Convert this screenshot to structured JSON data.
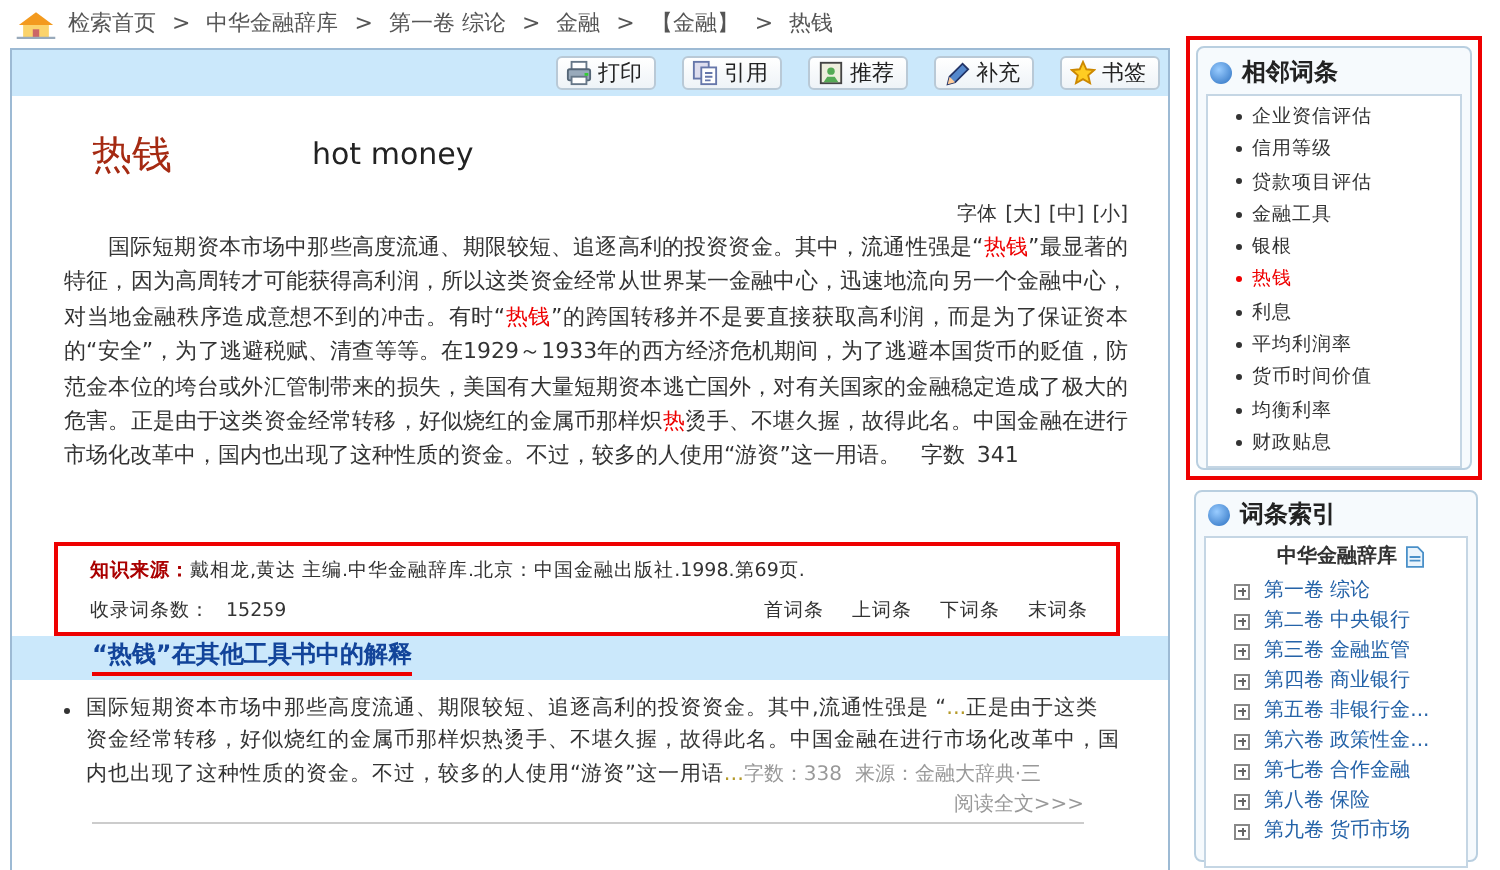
{
  "breadcrumb": [
    "检索首页",
    "中华金融辞库",
    "第一卷 综论",
    "金融",
    "【金融】",
    "热钱"
  ],
  "breadcrumb_separator": ">",
  "toolbar": [
    {
      "label": "打印",
      "kind": "print"
    },
    {
      "label": "引用",
      "kind": "cite"
    },
    {
      "label": "推荐",
      "kind": "recommend"
    },
    {
      "label": "补充",
      "kind": "supplement"
    },
    {
      "label": "书签",
      "kind": "bookmark"
    }
  ],
  "entry": {
    "title": "热钱",
    "english": "hot money",
    "font_size": {
      "label": "字体",
      "options": [
        "[大]",
        "[中]",
        "[小]"
      ]
    },
    "body": [
      {
        "text": "国际短期资本市场中那些高度流通、期限较短、追逐高利的投资资金。其中，流通性强是“",
        "highlight": false
      },
      {
        "text": "热钱",
        "highlight": true
      },
      {
        "text": "”最显著的特征，因为高周转才可能获得高利润，所以这类资金经常从世界某一金融中心，迅速地流向另一个金融中心，对当地金融秩序造成意想不到的冲击。有时“",
        "highlight": false
      },
      {
        "text": "热钱",
        "highlight": true
      },
      {
        "text": "”的跨国转移并不是要直接获取高利润，而是为了保证资本的“安全”，为了逃避税赋、清查等等。在1929～1933年的西方经济危机期间，为了逃避本国货币的贬值，防范金本位的垮台或外汇管制带来的损失，美国有大量短期资本逃亡国外，对有关国家的金融稳定造成了极大的危害。正是由于这类资金经常转移，好似烧红的金属币那样炽",
        "highlight": false
      },
      {
        "text": "热",
        "highlight": true
      },
      {
        "text": "烫手、不堪久握，故得此名。中国金融在进行市场化改革中，国内也出现了这种性质的资金。不过，较多的人使用“游资”这一用语。",
        "highlight": false
      }
    ],
    "char_count_label": "字数",
    "char_count": "341"
  },
  "source": {
    "label": "知识来源：",
    "text": "戴相龙,黄达 主编.中华金融辞库.北京：中国金融出版社.1998.第69页.",
    "count_label": "收录词条数：",
    "count": "15259",
    "nav": [
      "首词条",
      "上词条",
      "下词条",
      "末词条"
    ]
  },
  "other_tools": {
    "heading": "“热钱”在其他工具书中的解释",
    "results": [
      {
        "snippet": "国际短期资本市场中那些高度流通、期限较短、追逐高利的投资资金。其中,流通性强是 “",
        "ellipsis_before": "...",
        "snippet_end": "正是由于这类资金经常转移，好似烧红的金属币那样炽热烫手、不堪久握，故得此名。中国金融在进行市场化改革中，国内也出现了这种性质的资金。不过，较多的人使用“游资”这一用语",
        "ellipsis_after": "...",
        "meta": "字数：338  来源：金融大辞典·三"
      }
    ],
    "read_more": "阅读全文>>>"
  },
  "related": {
    "title": "相邻词条",
    "items": [
      {
        "label": "企业资信评估",
        "selected": false
      },
      {
        "label": "信用等级",
        "selected": false
      },
      {
        "label": "贷款项目评估",
        "selected": false
      },
      {
        "label": "金融工具",
        "selected": false
      },
      {
        "label": "银根",
        "selected": false
      },
      {
        "label": "热钱",
        "selected": true
      },
      {
        "label": "利息",
        "selected": false
      },
      {
        "label": "平均利润率",
        "selected": false
      },
      {
        "label": "货币时间价值",
        "selected": false
      },
      {
        "label": "均衡利率",
        "selected": false
      },
      {
        "label": "财政贴息",
        "selected": false
      }
    ]
  },
  "index": {
    "title": "词条索引",
    "book": "中华金融辞库",
    "volumes": [
      {
        "number": "第一卷",
        "name": "综论"
      },
      {
        "number": "第二卷",
        "name": "中央银行"
      },
      {
        "number": "第三卷",
        "name": "金融监管"
      },
      {
        "number": "第四卷",
        "name": "商业银行"
      },
      {
        "number": "第五卷",
        "name": "非银行金..."
      },
      {
        "number": "第六卷",
        "name": "政策性金..."
      },
      {
        "number": "第七卷",
        "name": "合作金融"
      },
      {
        "number": "第八卷",
        "name": "保险"
      },
      {
        "number": "第九卷",
        "name": "货币市场"
      }
    ]
  }
}
